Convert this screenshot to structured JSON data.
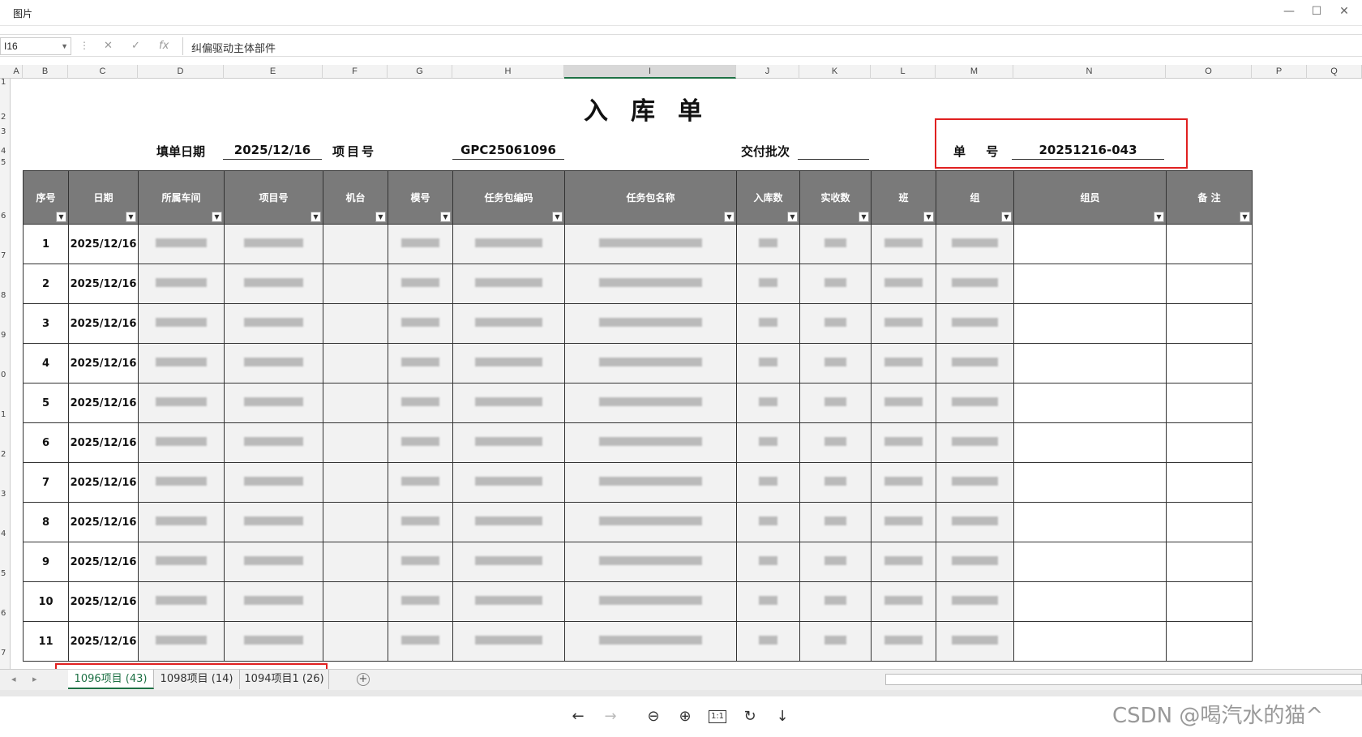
{
  "window": {
    "title": "图片",
    "min": "—",
    "max": "☐",
    "close": "✕"
  },
  "formula_bar": {
    "cell_ref": "I16",
    "cancel": "✕",
    "enter": "✓",
    "fx": "fx",
    "content": "纠偏驱动主体部件"
  },
  "columns": [
    "A",
    "B",
    "C",
    "D",
    "E",
    "F",
    "G",
    "H",
    "I",
    "J",
    "K",
    "L",
    "M",
    "N",
    "O",
    "P",
    "Q"
  ],
  "rows": [
    "1",
    "2",
    "3",
    "4",
    "5",
    "6",
    "7",
    "8",
    "9",
    "0",
    "1",
    "2",
    "3",
    "4",
    "5",
    "6",
    "7"
  ],
  "sheet": {
    "title": "入库单",
    "fill_date_label": "填单日期",
    "fill_date": "2025/12/16",
    "project_label": "项目号",
    "project_no": "GPC25061096",
    "batch_label": "交付批次",
    "batch_value": "",
    "order_label": "单 号",
    "order_no": "20251216-043"
  },
  "table": {
    "headers": [
      "序号",
      "日期",
      "所属车间",
      "项目号",
      "机台",
      "模号",
      "任务包编码",
      "任务包名称",
      "入库数",
      "实收数",
      "班",
      "组",
      "组员",
      "备 注"
    ],
    "rows": [
      {
        "no": "1",
        "date": "2025/12/16"
      },
      {
        "no": "2",
        "date": "2025/12/16"
      },
      {
        "no": "3",
        "date": "2025/12/16"
      },
      {
        "no": "4",
        "date": "2025/12/16"
      },
      {
        "no": "5",
        "date": "2025/12/16"
      },
      {
        "no": "6",
        "date": "2025/12/16"
      },
      {
        "no": "7",
        "date": "2025/12/16"
      },
      {
        "no": "8",
        "date": "2025/12/16"
      },
      {
        "no": "9",
        "date": "2025/12/16"
      },
      {
        "no": "10",
        "date": "2025/12/16"
      },
      {
        "no": "11",
        "date": "2025/12/16"
      }
    ]
  },
  "tabs": [
    "1096项目 (43)",
    "1098项目 (14)",
    "1094项目1 (26)"
  ],
  "add_tab": "+",
  "viewer": {
    "back": "←",
    "forward": "→",
    "zoom_out": "⊖",
    "zoom_in": "⊕",
    "actual": "1:1",
    "rotate": "↻",
    "download": "↓"
  },
  "watermark": "CSDN @喝汽水的猫^",
  "colors": {
    "accent_green": "#1e7145",
    "highlight_red": "#e02020",
    "header_gray": "#7a7a7a"
  }
}
